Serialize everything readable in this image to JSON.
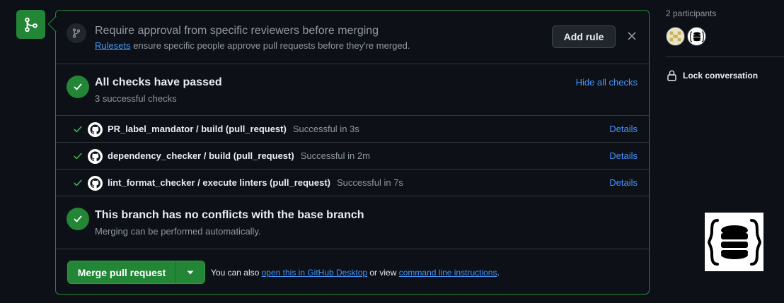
{
  "badge": {
    "icon": "git-merge-icon",
    "color": "#238636"
  },
  "rules_banner": {
    "title": "Require approval from specific reviewers before merging",
    "link_text": "Rulesets",
    "description": " ensure specific people approve pull requests before they're merged.",
    "add_rule_label": "Add rule",
    "close_icon": "x-icon"
  },
  "checks": {
    "title": "All checks have passed",
    "subtitle": "3 successful checks",
    "toggle_label": "Hide all checks",
    "items": [
      {
        "name": "PR_label_mandator / build (pull_request)",
        "status": "Successful in 3s",
        "details_label": "Details"
      },
      {
        "name": "dependency_checker / build (pull_request)",
        "status": "Successful in 2m",
        "details_label": "Details"
      },
      {
        "name": "lint_format_checker / execute linters (pull_request)",
        "status": "Successful in 7s",
        "details_label": "Details"
      }
    ]
  },
  "conflicts": {
    "title": "This branch has no conflicts with the base branch",
    "subtitle": "Merging can be performed automatically."
  },
  "merge": {
    "button_label": "Merge pull request",
    "note_prefix": "You can also ",
    "desktop_link": "open this in GitHub Desktop",
    "note_middle": " or view ",
    "cli_link": "command line instructions",
    "note_suffix": "."
  },
  "sidebar": {
    "participants_label": "2 participants",
    "lock_label": "Lock conversation",
    "lock_icon": "lock-icon"
  },
  "colors": {
    "success": "#238636",
    "link": "#4493f8",
    "background": "#0d1117",
    "border": "#30363d"
  }
}
